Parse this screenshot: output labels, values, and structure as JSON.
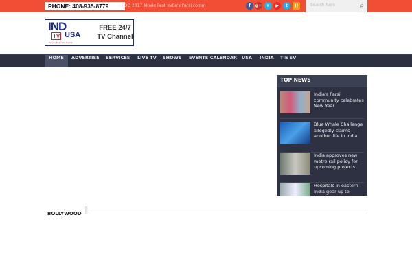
{
  "topbar": {
    "phone": "PHONE: 408-935-8779",
    "ticker": [
      "FOG 2017 Movie Fest",
      "India's Parsi comm"
    ],
    "social": [
      {
        "name": "facebook",
        "glyph": "f",
        "color": "#3b5998"
      },
      {
        "name": "google-plus",
        "glyph": "g+",
        "color": "#c0392b"
      },
      {
        "name": "vimeo",
        "glyph": "v",
        "color": "#1ab7ea"
      },
      {
        "name": "youtube",
        "glyph": "▶",
        "color": "#e52d27"
      },
      {
        "name": "twitter",
        "glyph": "t",
        "color": "#2ba9e1"
      },
      {
        "name": "rss",
        "glyph": "))",
        "color": "#f39c12"
      }
    ],
    "search_placeholder": "Search here"
  },
  "logo": {
    "ind": "IND",
    "tv": "TV",
    "usa": "USA",
    "tagline": "Inform-Entertain-Inspire",
    "free": "FREE 24/7",
    "channel": "TV Channel"
  },
  "nav": [
    "HOME",
    "ADVERTISE",
    "SERVICES",
    "LIVE TV",
    "SHOWS",
    "EVENTS CALENDAR",
    "USA",
    "INDIA",
    "TIE SV"
  ],
  "top_news": {
    "title": "TOP NEWS",
    "items": [
      "India's Parsi community celebrates New Year",
      "Blue Whale Challenge allegedly claims another life in India",
      "India approves new metro rail policy for upcoming projects",
      "Hospitals in eastern India gear up to"
    ]
  },
  "section": {
    "title": "BOLLYWOOD"
  }
}
